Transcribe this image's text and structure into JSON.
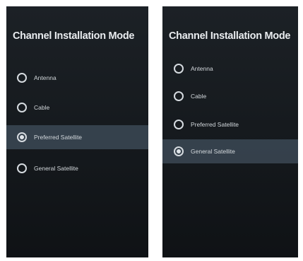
{
  "screens": [
    {
      "title": "Channel Installation Mode",
      "options": [
        {
          "label": "Antenna",
          "selected": false
        },
        {
          "label": "Cable",
          "selected": false
        },
        {
          "label": "Preferred Satellite",
          "selected": true
        },
        {
          "label": "General Satellite",
          "selected": false
        }
      ]
    },
    {
      "title": "Channel Installation Mode",
      "options": [
        {
          "label": "Antenna",
          "selected": false
        },
        {
          "label": "Cable",
          "selected": false
        },
        {
          "label": "Preferred Satellite",
          "selected": false
        },
        {
          "label": "General Satellite",
          "selected": true
        }
      ]
    }
  ],
  "colors": {
    "panel_bg": "#1a1f24",
    "selected_row": "#506272",
    "text": "#e9ecef"
  },
  "icons": [
    "radio-button-icon"
  ]
}
